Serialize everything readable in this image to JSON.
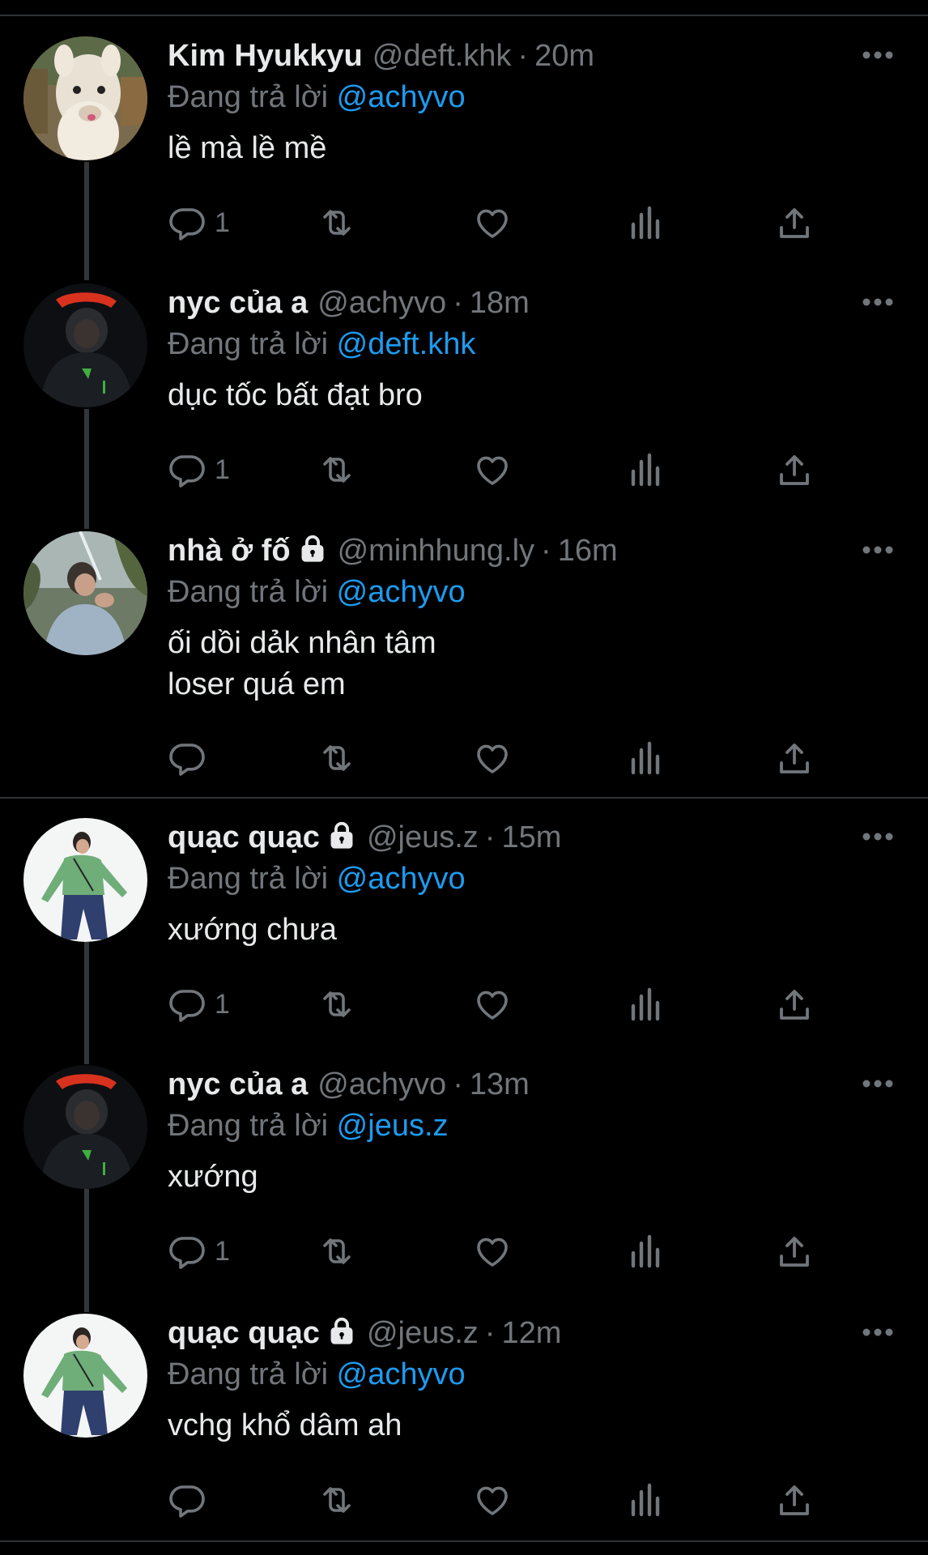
{
  "tweets": [
    {
      "name": "Kim Hyukkyu",
      "locked": false,
      "handle": "@deft.khk",
      "time": "20m",
      "reply_prefix": "Đang trả lời",
      "reply_to": "@achyvo",
      "text": "lề mà lề mề",
      "reply_count": "1",
      "avatar": "alpaca-avatar"
    },
    {
      "name": "nyc của a",
      "locked": false,
      "handle": "@achyvo",
      "time": "18m",
      "reply_prefix": "Đang trả lời",
      "reply_to": "@deft.khk",
      "text": "dục tốc bất đạt bro",
      "reply_count": "1",
      "avatar": "dark-hoodie-avatar"
    },
    {
      "name": "nhà ở fố",
      "locked": true,
      "handle": "@minhhung.ly",
      "time": "16m",
      "reply_prefix": "Đang trả lời",
      "reply_to": "@achyvo",
      "text": "ối dồi dảk nhân tâm\nloser quá em",
      "reply_count": "",
      "avatar": "outdoor-photo-avatar"
    },
    {
      "name": "quạc quạc",
      "locked": true,
      "handle": "@jeus.z",
      "time": "15m",
      "reply_prefix": "Đang trả lời",
      "reply_to": "@achyvo",
      "text": "xướng chưa",
      "reply_count": "1",
      "avatar": "green-jacket-avatar"
    },
    {
      "name": "nyc của a",
      "locked": false,
      "handle": "@achyvo",
      "time": "13m",
      "reply_prefix": "Đang trả lời",
      "reply_to": "@jeus.z",
      "text": "xướng",
      "reply_count": "1",
      "avatar": "dark-hoodie-avatar"
    },
    {
      "name": "quạc quạc",
      "locked": true,
      "handle": "@jeus.z",
      "time": "12m",
      "reply_prefix": "Đang trả lời",
      "reply_to": "@achyvo",
      "text": "vchg khổ dâm ah",
      "reply_count": "",
      "avatar": "green-jacket-avatar"
    }
  ],
  "colors": {
    "background": "#000000",
    "text": "#e7e9ea",
    "secondary": "#71767b",
    "link": "#1d9bf0",
    "divider": "#2f3336"
  },
  "icons": [
    "reply-icon",
    "retweet-icon",
    "like-icon",
    "views-icon",
    "share-icon",
    "more-icon",
    "lock-icon"
  ]
}
